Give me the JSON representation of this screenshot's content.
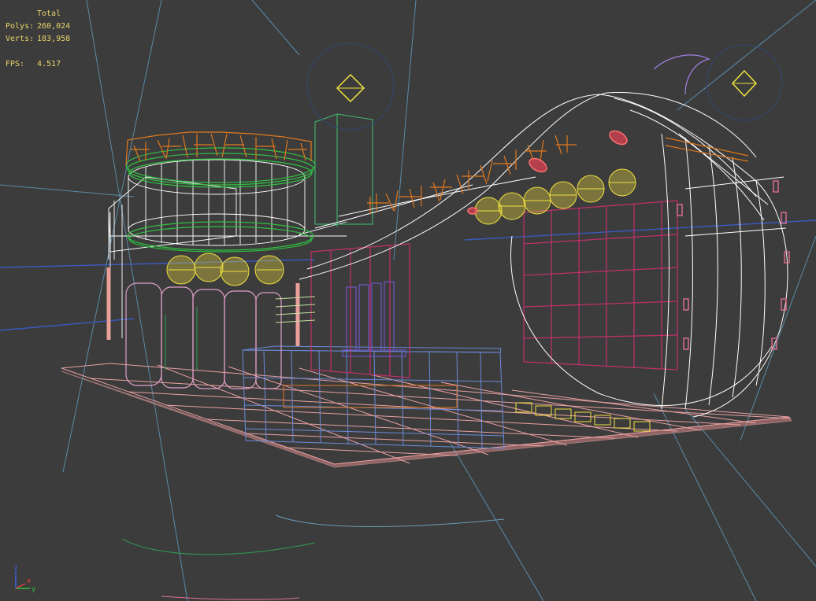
{
  "stats": {
    "header": "Total",
    "polys_label": "Polys:",
    "polys_value": "260,024",
    "verts_label": "Verts:",
    "verts_value": "183,958",
    "fps_label": "FPS:",
    "fps_value": "4.517"
  },
  "axis": {
    "z": "z",
    "x": "x",
    "y": "y"
  },
  "colors": {
    "background": "#3c3c3c",
    "stats_text": "#e8d36a",
    "floor_grid": "#e8a0a0",
    "structure": "#ffffff",
    "lanterns": "#f0e040",
    "signage": "#e0781e",
    "ring": "#30c040",
    "panels": "#c0306a",
    "counter": "#6a8ad8",
    "guides": "#6a9ab8"
  }
}
